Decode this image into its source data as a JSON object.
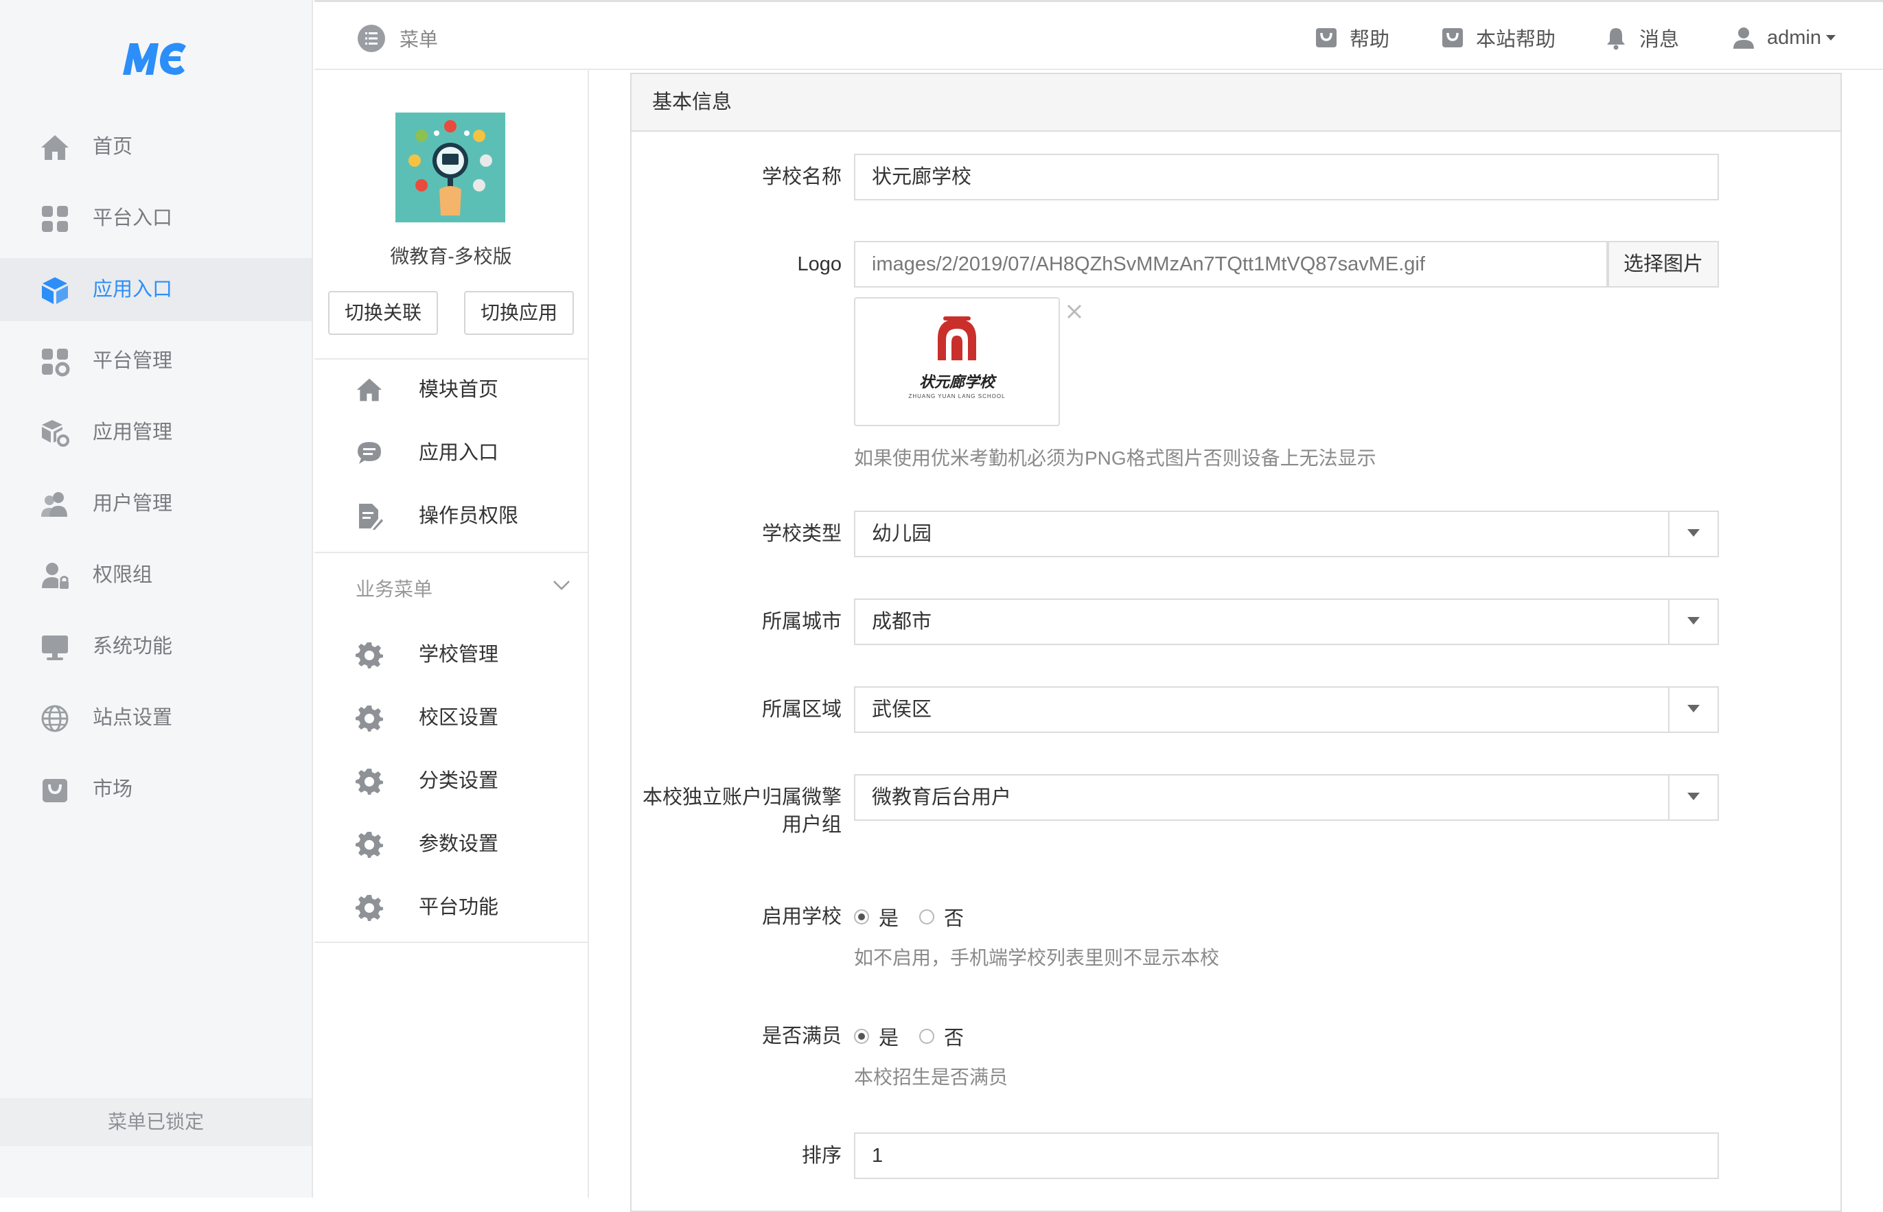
{
  "app": {
    "logo_text": "MC",
    "brand_color": "#2c8ef8"
  },
  "leftnav": {
    "items": [
      {
        "label": "首页",
        "icon": "home-icon"
      },
      {
        "label": "平台入口",
        "icon": "grid-icon"
      },
      {
        "label": "应用入口",
        "icon": "cube-icon",
        "active": true
      },
      {
        "label": "平台管理",
        "icon": "grid-gear-icon"
      },
      {
        "label": "应用管理",
        "icon": "box-gear-icon"
      },
      {
        "label": "用户管理",
        "icon": "users-icon"
      },
      {
        "label": "权限组",
        "icon": "user-lock-icon"
      },
      {
        "label": "系统功能",
        "icon": "monitor-icon"
      },
      {
        "label": "站点设置",
        "icon": "globe-icon"
      },
      {
        "label": "市场",
        "icon": "bag-icon"
      }
    ],
    "footer": "菜单已锁定"
  },
  "topbar": {
    "menu_label": "菜单",
    "help": "帮助",
    "site_help": "本站帮助",
    "messages": "消息",
    "user": "admin"
  },
  "subnav": {
    "app_name": "微教育-多校版",
    "switch_link": "切换关联",
    "switch_app": "切换应用",
    "items": [
      {
        "label": "模块首页",
        "icon": "home-icon"
      },
      {
        "label": "应用入口",
        "icon": "chat-icon"
      },
      {
        "label": "操作员权限",
        "icon": "document-edit-icon"
      }
    ],
    "business_header": "业务菜单",
    "business_items": [
      {
        "label": "学校管理",
        "icon": "gear-icon"
      },
      {
        "label": "校区设置",
        "icon": "gear-icon"
      },
      {
        "label": "分类设置",
        "icon": "gear-icon"
      },
      {
        "label": "参数设置",
        "icon": "gear-icon"
      },
      {
        "label": "平台功能",
        "icon": "gear-icon"
      }
    ]
  },
  "form": {
    "panel_title": "基本信息",
    "school_name": {
      "label": "学校名称",
      "value": "状元廊学校"
    },
    "logo": {
      "label": "Logo",
      "value": "images/2/2019/07/AH8QZhSvMMzAn7TQtt1MtVQ87savME.gif",
      "button": "选择图片",
      "help": "如果使用优米考勤机必须为PNG格式图片否则设备上无法显示",
      "preview_text": "状元廊学校",
      "preview_sub": "ZHUANG YUAN LANG SCHOOL"
    },
    "school_type": {
      "label": "学校类型",
      "value": "幼儿园"
    },
    "city": {
      "label": "所属城市",
      "value": "成都市"
    },
    "district": {
      "label": "所属区域",
      "value": "武侯区"
    },
    "user_group": {
      "label_line1": "本校独立账户归属微擎",
      "label_line2": "用户组",
      "value": "微教育后台用户"
    },
    "enable_school": {
      "label": "启用学校",
      "yes": "是",
      "no": "否",
      "selected": "是",
      "help": "如不启用，手机端学校列表里则不显示本校"
    },
    "is_full": {
      "label": "是否满员",
      "yes": "是",
      "no": "否",
      "selected": "是",
      "help": "本校招生是否满员"
    },
    "sort": {
      "label": "排序",
      "value": "1"
    }
  }
}
